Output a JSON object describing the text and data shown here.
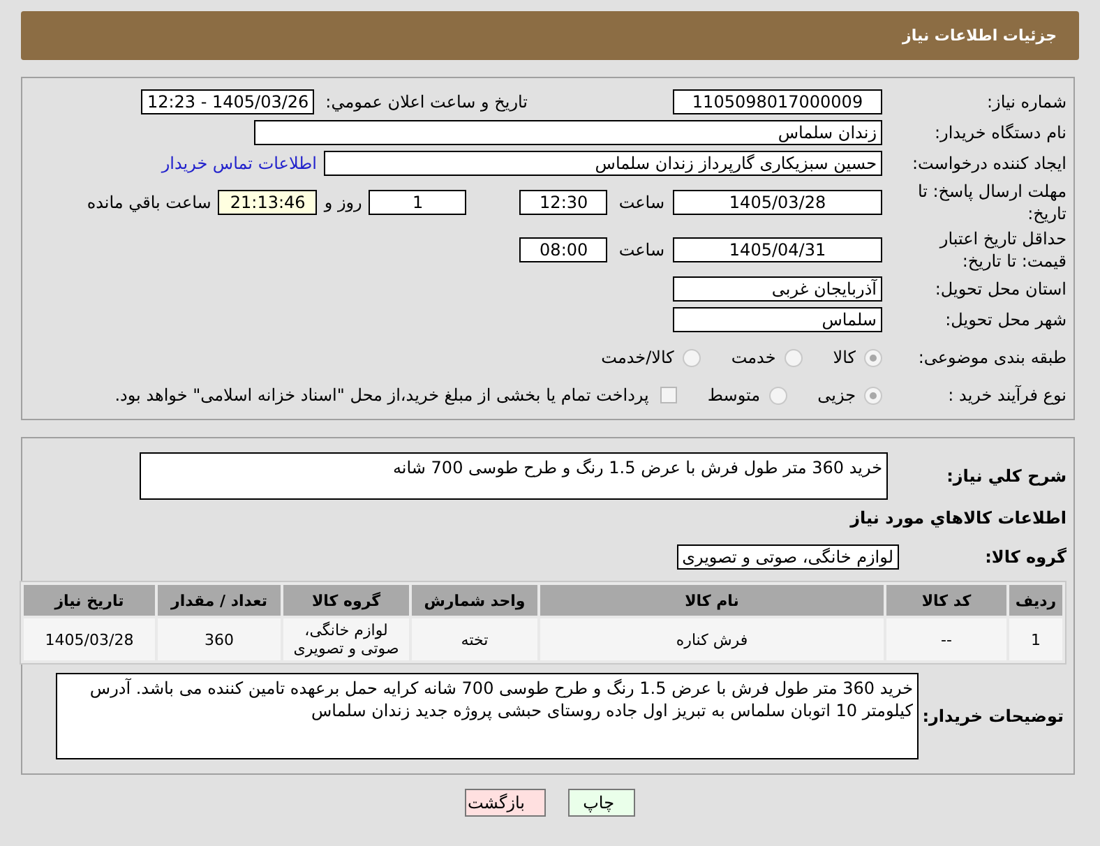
{
  "header": {
    "title": "جزئیات اطلاعات نیاز"
  },
  "need_number": {
    "label": "شماره نیاز:",
    "value": "1105098017000009"
  },
  "announce": {
    "label": "تاریخ و ساعت اعلان عمومي:",
    "value": "1405/03/26 - 12:23"
  },
  "buyer_org": {
    "label": "نام دستگاه خریدار:",
    "value": "زندان سلماس"
  },
  "requester": {
    "label": "ایجاد کننده درخواست:",
    "value": "حسین سبزیکاری گارپرداز زندان سلماس",
    "link": "اطلاعات تماس خریدار"
  },
  "deadline": {
    "label": "مهلت ارسال پاسخ: تا تاریخ:",
    "date": "1405/03/28",
    "time_label": "ساعت",
    "time": "12:30",
    "days": "1",
    "days_label": "روز و",
    "remaining": "21:13:46",
    "remaining_label": "ساعت باقي مانده"
  },
  "price_validity": {
    "label": "حداقل تاریخ اعتبار قیمت: تا تاریخ:",
    "date": "1405/04/31",
    "time_label": "ساعت",
    "time": "08:00"
  },
  "province": {
    "label": "استان محل تحویل:",
    "value": "آذربایجان غربی"
  },
  "city": {
    "label": "شهر محل تحویل:",
    "value": "سلماس"
  },
  "category": {
    "label": "طبقه بندی موضوعی:",
    "options": [
      {
        "label": "کالا",
        "selected": true
      },
      {
        "label": "خدمت",
        "selected": false
      },
      {
        "label": "کالا/خدمت",
        "selected": false
      }
    ]
  },
  "process": {
    "label": "نوع فرآیند خرید :",
    "options": [
      {
        "label": "جزیی",
        "selected": true
      },
      {
        "label": "متوسط",
        "selected": false
      }
    ],
    "treasury": {
      "label": "پرداخت تمام یا بخشی از مبلغ خرید،از محل \"اسناد خزانه اسلامی\" خواهد بود.",
      "checked": false
    }
  },
  "summary": {
    "label": "شرح کلي نیاز:",
    "value": "خرید 360 متر طول فرش با عرض 1.5 رنگ و طرح طوسی 700 شانه"
  },
  "goods_title": "اطلاعات کالاهاي مورد نیاز",
  "goods_group": {
    "label": "گروه کالا:",
    "value": "لوازم خانگی، صوتی و تصویری"
  },
  "table": {
    "columns": [
      "ردیف",
      "کد کالا",
      "نام کالا",
      "واحد شمارش",
      "گروه کالا",
      "تعداد / مقدار",
      "تاریخ نیاز"
    ],
    "rows": [
      [
        "1",
        "--",
        "فرش کناره",
        "تخته",
        "لوازم خانگی، صوتی و تصویری",
        "360",
        "1405/03/28"
      ]
    ]
  },
  "buyer_notes": {
    "label": "توضیحات خریدار:",
    "value": "خرید 360 متر طول فرش با عرض 1.5 رنگ و طرح طوسی 700 شانه کرایه حمل برعهده تامین کننده می باشد. آدرس کیلومتر 10 اتوبان سلماس به تبریز اول جاده روستای حبشی پروژه جدید زندان سلماس"
  },
  "buttons": [
    {
      "label": "چاپ",
      "kind": "print"
    },
    {
      "label": "بازگشت",
      "kind": "back"
    }
  ]
}
